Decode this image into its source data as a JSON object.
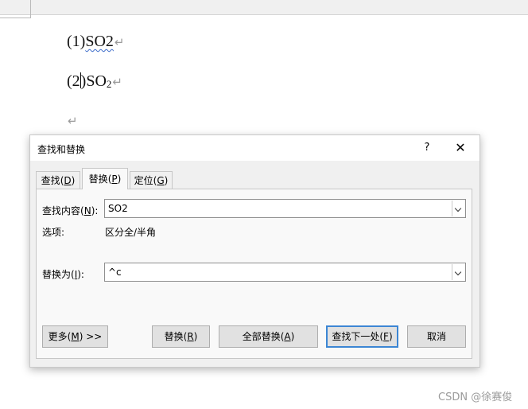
{
  "document": {
    "line1": {
      "prefix": "(1)",
      "text": "SO2",
      "para_mark": "↵"
    },
    "line2": {
      "prefix_start": "(2",
      "prefix_end": ")",
      "text_main": "SO",
      "text_sub": "2",
      "para_mark": "↵"
    },
    "line3": {
      "para_mark": "↵"
    }
  },
  "dialog": {
    "title": "查找和替换",
    "help_label": "?",
    "close_label": "✕",
    "tabs": {
      "find": {
        "label": "查找",
        "hotkey": "D"
      },
      "replace": {
        "label": "替换",
        "hotkey": "P"
      },
      "goto": {
        "label": "定位",
        "hotkey": "G"
      }
    },
    "active_tab": "replace",
    "find": {
      "label": "查找内容",
      "hotkey": "N",
      "value": "SO2"
    },
    "options": {
      "label": "选项:",
      "value": "区分全/半角"
    },
    "replace_with": {
      "label": "替换为",
      "hotkey": "I",
      "value": "^c"
    },
    "buttons": {
      "more": {
        "label": "更多",
        "hotkey": "M",
        "suffix": " >>"
      },
      "replace": {
        "label": "替换",
        "hotkey": "R"
      },
      "replace_all": {
        "label": "全部替换",
        "hotkey": "A"
      },
      "find_next": {
        "label": "查找下一处",
        "hotkey": "F"
      },
      "cancel": {
        "label": "取消"
      }
    }
  },
  "watermark": "CSDN @徐赛俊"
}
